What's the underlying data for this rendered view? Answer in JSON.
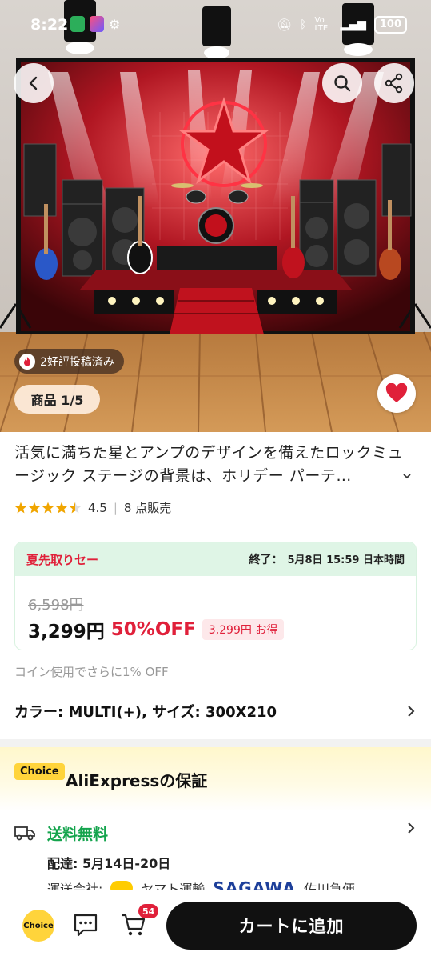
{
  "status_bar": {
    "time": "8:22",
    "battery": "100",
    "network": "Vo LTE"
  },
  "hero": {
    "image_subject": "rock concert stage backdrop with neon star, amplifiers, drum kit and guitars on wooden floor",
    "review_badge": "2好評投稿済み",
    "image_counter": "商品 1/5"
  },
  "product": {
    "title": "活気に満ちた星とアンプのデザインを備えたロックミュージック ステージの背景は、ホリデー パーテ…",
    "rating": "4.5",
    "sold": "8 点販売",
    "stars_filled": 4.5
  },
  "sale": {
    "name": "夏先取りセー",
    "end_label": "終了：",
    "end_time": "5月8日 15:59 日本時間",
    "original_price": "6,598円",
    "price": "3,299円",
    "discount": "50%OFF",
    "saving": "3,299円 お得"
  },
  "coin_note": "コイン使用でさらに1% OFF",
  "variant": {
    "text": "カラー: MULTI(+), サイズ: 300X210"
  },
  "guarantee": {
    "badge": "Choice",
    "title": "AliExpressの保証"
  },
  "shipping": {
    "free_label": "送料無料",
    "delivery": "配達: 5月14日-20日",
    "carrier_label": "運送会社:",
    "carrier_1": "ヤマト運輸",
    "carrier_2_logo": "SAGAWA",
    "carrier_2": "佐川急便"
  },
  "bottom_bar": {
    "choice": "Choice",
    "cart_count": "54",
    "add_to_cart": "カートに追加"
  },
  "colors": {
    "accent_red": "#e0203a",
    "sale_green": "#dff5e6",
    "free_ship_green": "#14a44d",
    "choice_yellow": "#ffd43b",
    "cta_black": "#111111"
  }
}
